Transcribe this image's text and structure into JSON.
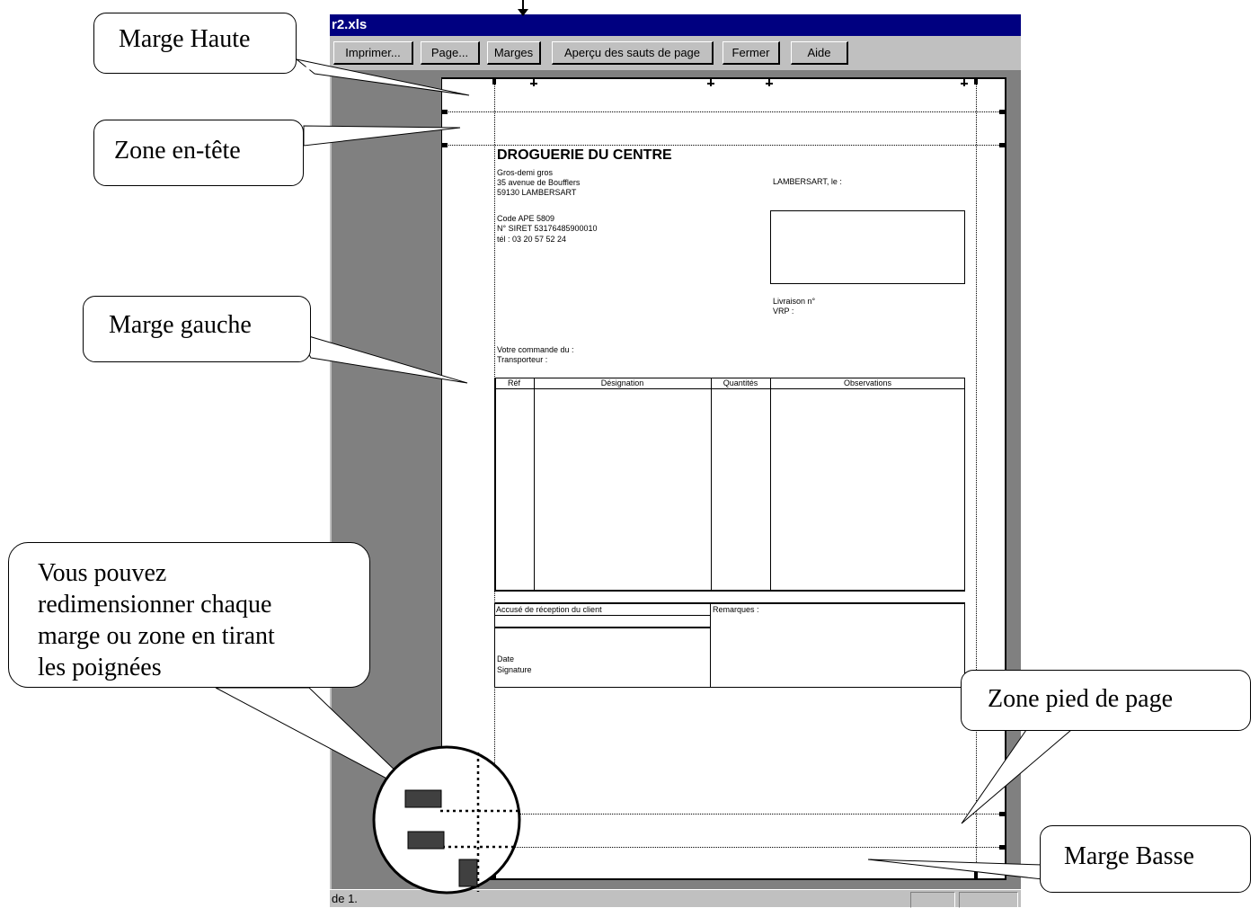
{
  "window": {
    "title": "r2.xls"
  },
  "toolbar": {
    "print": "Imprimer...",
    "page": "Page...",
    "margins": "Marges",
    "page_breaks": "Aperçu des sauts de page",
    "close": "Fermer",
    "help": "Aide"
  },
  "statusbar": {
    "text": "de 1."
  },
  "document": {
    "company": "DROGUERIE DU CENTRE",
    "lines": [
      "Gros-demi gros",
      "35 avenue de Boufflers",
      "59130 LAMBERSART"
    ],
    "code_lines": [
      "Code APE 5809",
      "N° SIRET 53176485900010",
      "tél : 03 20 57 52 24"
    ],
    "place_date": "LAMBERSART, le :",
    "delivery": [
      "Livraison n°",
      "VRP :"
    ],
    "order": [
      "Votre commande du :",
      "Transporteur :"
    ],
    "table_headers": [
      "Réf",
      "Désignation",
      "Quantités",
      "Observations"
    ],
    "receipt_label": "Accusé de réception du client",
    "remarks_label": "Remarques :",
    "date_sign": [
      "Date",
      "Signature"
    ]
  },
  "callouts": {
    "top_margin": "Marge Haute",
    "header_zone": "Zone en-tête",
    "left_margin": "Marge gauche",
    "resize_tip": [
      "Vous pouvez",
      "redimensionner chaque",
      "marge ou zone en tirant",
      "les poignées"
    ],
    "footer_zone": "Zone pied de page",
    "bottom_margin": "Marge Basse"
  }
}
